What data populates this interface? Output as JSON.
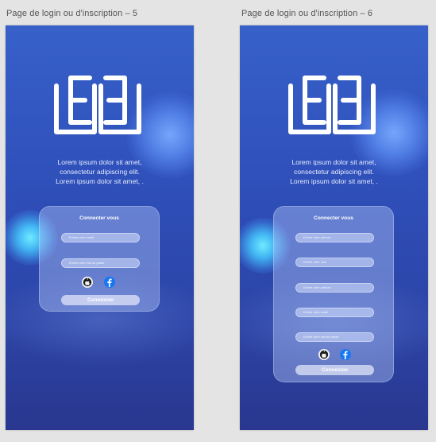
{
  "frames": [
    {
      "title": "Page de login ou d'inscription – 5",
      "tagline": [
        "Lorem ipsum dolor sit amet,",
        "consectetur adipiscing elit.",
        "Lorem ipsum dolor sit amet, ."
      ],
      "card_title": "Connecter vous",
      "fields": [
        "Entrée votre email",
        "Entrée votre mot de passe"
      ],
      "button": "Connexion"
    },
    {
      "title": "Page de login ou d'inscription – 6",
      "tagline": [
        "Lorem ipsum dolor sit amet,",
        "consectetur adipiscing elit.",
        "Lorem ipsum dolor sit amet, ."
      ],
      "card_title": "Connecter vous",
      "fields": [
        "Entrée votre prénom",
        "Entrée votre nom",
        "Entrée votre prénom",
        "Entrée votre email",
        "Entrée votre mot de passe"
      ],
      "button": "Connexion"
    }
  ],
  "icons": [
    "book-logo-icon",
    "apple-icon",
    "facebook-icon"
  ],
  "colors": {
    "accent": "#2f4fb9",
    "facebook": "#1877f2"
  }
}
